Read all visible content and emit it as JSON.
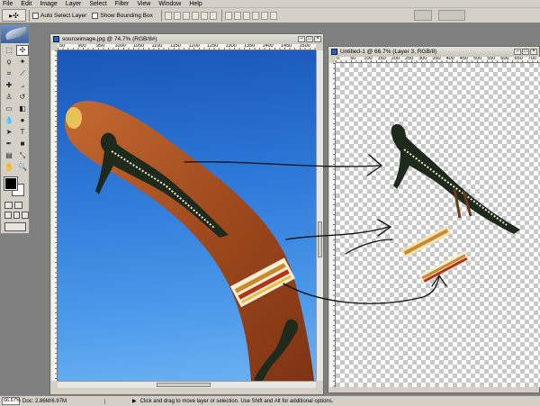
{
  "menu": [
    "File",
    "Edit",
    "Image",
    "Layer",
    "Select",
    "Filter",
    "View",
    "Window",
    "Help"
  ],
  "options": {
    "tool_glyph": "▸✣",
    "auto_select_label": "Auto Select Layer",
    "show_bounding_label": "Show Bounding Box"
  },
  "source_window": {
    "title": "sourceimage.jpg @ 74.7% (RGB/8#)",
    "ruler_labels": [
      "50",
      "900",
      "950",
      "1000",
      "1050",
      "1100",
      "1150",
      "1200",
      "1250",
      "1300",
      "1350",
      "1400",
      "1450",
      "1500"
    ]
  },
  "target_window": {
    "title": "Untitled-1 @ 66.7% (Layer 3, RGB/8)",
    "ruler_labels": [
      "0",
      "50",
      "100",
      "150",
      "200",
      "250",
      "300",
      "350",
      "400",
      "450",
      "500",
      "550",
      "600",
      "650",
      "700"
    ]
  },
  "status": {
    "zoom": "66.67%",
    "doc": "Doc: 2.86M/6.97M",
    "hint": "Click and drag to move layer or selection.  Use Shift and Alt for additional options."
  },
  "colors": {
    "sky": "#2d78d8",
    "boomerang": "#a84e22",
    "kangaroo": "#1e2a1c",
    "ui_gray": "#d4d0c8"
  },
  "icons": [
    "move-tool-icon",
    "feather-icon",
    "window-minimize-icon",
    "window-maximize-icon",
    "window-close-icon"
  ]
}
